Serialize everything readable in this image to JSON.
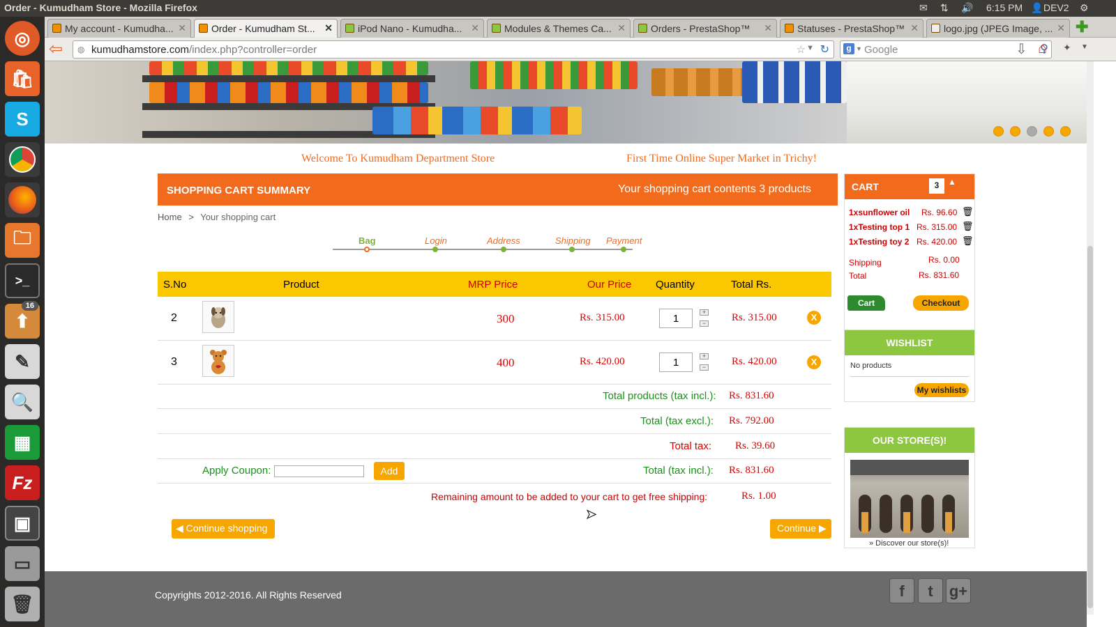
{
  "window": {
    "title": "Order - Kumudham Store - Mozilla Firefox"
  },
  "system": {
    "time": "6:15 PM",
    "user": "DEV2"
  },
  "launcher": {
    "badge": "16"
  },
  "tabs": [
    {
      "label": "My account - Kumudha..."
    },
    {
      "label": "Order - Kumudham St..."
    },
    {
      "label": "iPod Nano - Kumudha..."
    },
    {
      "label": "Modules & Themes Ca..."
    },
    {
      "label": "Orders - PrestaShop™"
    },
    {
      "label": "Statuses - PrestaShop™"
    },
    {
      "label": "logo.jpg (JPEG Image, ..."
    }
  ],
  "nav": {
    "url_domain": "kumudhamstore.com",
    "url_path": "/index.php?controller=order",
    "search_placeholder": "Google"
  },
  "header": {
    "welcome": "Welcome To Kumudham Department Store",
    "tagline": "First Time Online Super Market in Trichy!"
  },
  "summary": {
    "title": "SHOPPING CART SUMMARY",
    "contents": "Your shopping cart contents 3 products"
  },
  "breadcrumb": {
    "home": "Home",
    "sep": ">",
    "current": "Your shopping cart"
  },
  "steps": [
    "Bag",
    "Login",
    "Address",
    "Shipping",
    "Payment"
  ],
  "table": {
    "headers": {
      "sno": "S.No",
      "product": "Product",
      "mrp": "MRP Price",
      "our": "Our Price",
      "qty": "Quantity",
      "total": "Total Rs."
    },
    "rows": [
      {
        "sno": "2",
        "mrp": "300",
        "our": "Rs. 315.00",
        "qty": "1",
        "total": "Rs. 315.00"
      },
      {
        "sno": "3",
        "mrp": "400",
        "our": "Rs. 420.00",
        "qty": "1",
        "total": "Rs. 420.00"
      }
    ]
  },
  "totals": {
    "products_label": "Total products (tax incl.):",
    "products_value": "Rs. 831.60",
    "excl_label": "Total (tax excl.):",
    "excl_value": "Rs. 792.00",
    "tax_label": "Total tax:",
    "tax_value": "Rs. 39.60",
    "incl_label": "Total (tax incl.):",
    "incl_value": "Rs. 831.60",
    "free_label": "Remaining amount to be added to your cart to get free shipping:",
    "free_value": "Rs. 1.00"
  },
  "coupon": {
    "label": "Apply Coupon:",
    "button": "Add"
  },
  "buttons": {
    "continue_shopping": "Continue shopping",
    "continue": "Continue"
  },
  "cart": {
    "title": "CART",
    "count": "3",
    "items": [
      {
        "name": "1xsunflower oil",
        "price": "Rs. 96.60"
      },
      {
        "name": "1xTesting top 1",
        "price": "Rs. 315.00"
      },
      {
        "name": "1xTesting toy 2",
        "price": "Rs. 420.00"
      }
    ],
    "shipping_label": "Shipping",
    "shipping_value": "Rs. 0.00",
    "total_label": "Total",
    "total_value": "Rs. 831.60",
    "cart_button": "Cart",
    "checkout_button": "Checkout"
  },
  "wishlist": {
    "title": "WISHLIST",
    "empty": "No products",
    "button": "My wishlists"
  },
  "stores": {
    "title": "OUR STORE(S)!",
    "link": "» Discover our store(s)!"
  },
  "footer": {
    "copyright": "Copyrights 2012-2016. All Rights Reserved"
  },
  "colors": {
    "orange": "#f26a1b",
    "yellow": "#fbc800",
    "green": "#8dc63f",
    "red": "#d00000"
  }
}
